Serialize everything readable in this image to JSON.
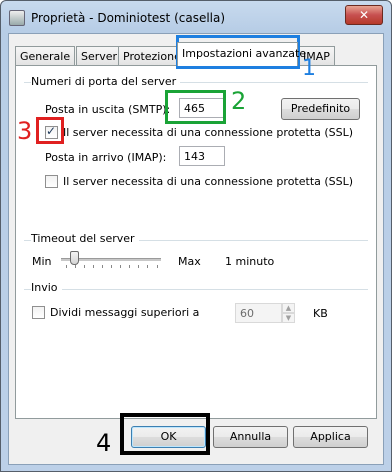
{
  "window": {
    "title": "Proprietà - Dominiotest (casella)",
    "close_glyph": "✕"
  },
  "tabs": [
    {
      "label": "Generale"
    },
    {
      "label": "Server"
    },
    {
      "label": "Protezione"
    },
    {
      "label": "Impostazioni avanzate",
      "selected": true
    },
    {
      "label": "IMAP"
    }
  ],
  "port_group": {
    "title": "Numeri di porta del server",
    "smtp_label": "Posta in uscita (SMTP):",
    "smtp_value": "465",
    "default_button": "Predefinito",
    "smtp_ssl_label": "Il server necessita di una connessione protetta (SSL)",
    "smtp_ssl_checked": true,
    "imap_label": "Posta in arrivo (IMAP):",
    "imap_value": "143",
    "imap_ssl_label": "Il server necessita di una connessione protetta (SSL)",
    "imap_ssl_checked": false
  },
  "timeout_group": {
    "title": "Timeout del server",
    "min_label": "Min",
    "max_label": "Max",
    "value_text": "1 minuto",
    "slider_fraction": 0.1
  },
  "send_group": {
    "title": "Invio",
    "split_label": "Dividi messaggi superiori a",
    "split_checked": false,
    "size_value": "60",
    "unit_label": "KB"
  },
  "buttons": {
    "ok": "OK",
    "cancel": "Annulla",
    "apply": "Applica"
  },
  "annotations": [
    {
      "number": "1",
      "color": "#1e7fe0"
    },
    {
      "number": "2",
      "color": "#1aa336"
    },
    {
      "number": "3",
      "color": "#e02020"
    },
    {
      "number": "4",
      "color": "#000000"
    }
  ],
  "colors": {
    "annotation_blue": "#1e7fe0",
    "annotation_green": "#1aa336",
    "annotation_red": "#e02020",
    "annotation_black": "#000000"
  }
}
